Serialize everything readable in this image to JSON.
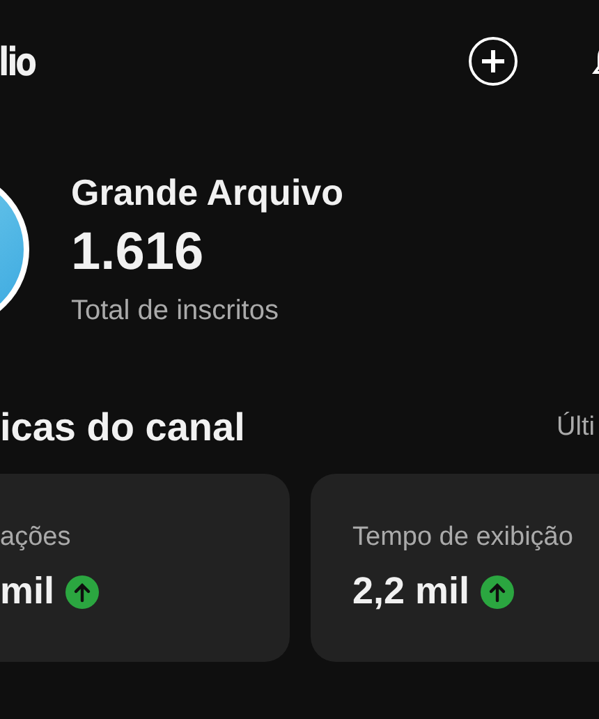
{
  "header": {
    "title": "lio"
  },
  "channel": {
    "name": "Grande Arquivo",
    "subscribers": "1.616",
    "subscribers_label": "Total de inscritos"
  },
  "analytics": {
    "title": "icas do canal",
    "period": "Últi",
    "cards": [
      {
        "label": "ações",
        "value": "mil",
        "rising": true
      },
      {
        "label": "Tempo de exibição",
        "value": "2,2 mil",
        "rising": true
      }
    ]
  }
}
